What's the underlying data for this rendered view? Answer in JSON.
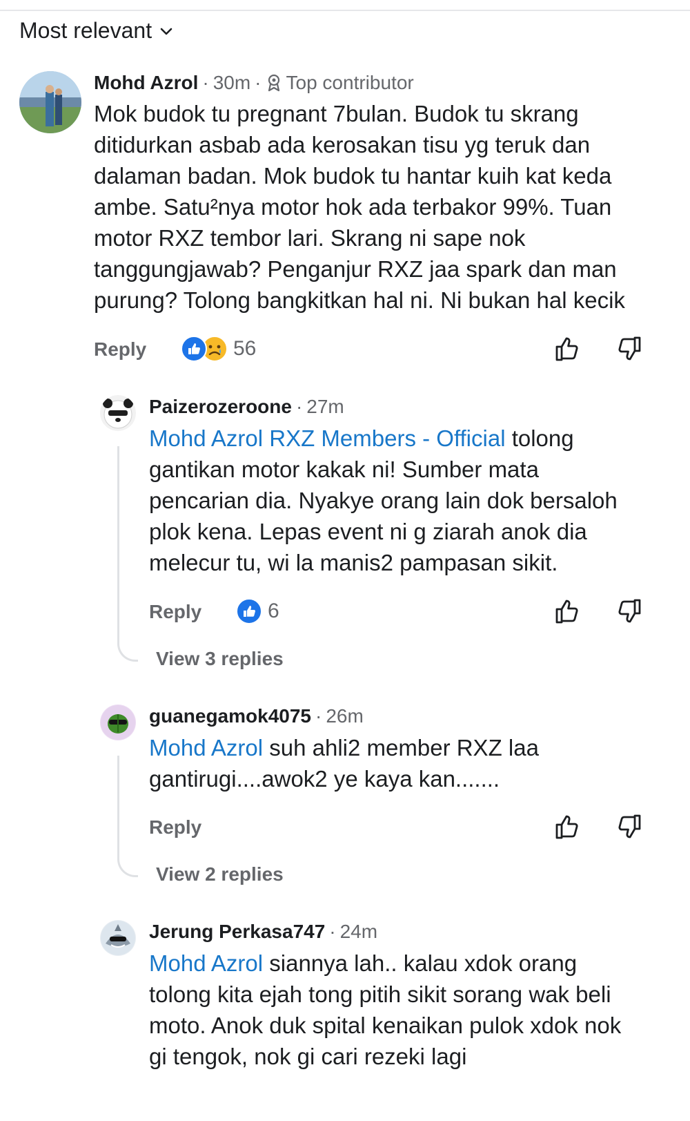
{
  "sort": {
    "label": "Most relevant"
  },
  "comments": [
    {
      "author": "Mohd Azrol",
      "time": "30m",
      "badge": "Top contributor",
      "lines": [
        "Mok budok tu pregnant 7bulan. Budok tu skrang",
        "ditidurkan asbab ada kerosakan tisu yg teruk dan",
        "dalaman badan. Mok budok tu hantar kuih kat keda",
        "ambe. Satu²nya motor hok ada terbakor 99%. Tuan",
        "motor RXZ tembor lari. Skrang ni sape nok",
        "tanggungjawab? Penganjur RXZ jaa spark dan man",
        "purung? Tolong bangkitkan hal ni. Ni bukan hal kecik"
      ],
      "reply_label": "Reply",
      "reaction_count": "56",
      "reactions": [
        "like",
        "sad"
      ]
    },
    {
      "author": "Paizerozeroone",
      "time": "27m",
      "mention": "Mohd Azrol RXZ Members - Official",
      "lines": [
        " tolong",
        "gantikan motor kakak ni! Sumber mata",
        "pencarian dia. Nyakye orang lain dok bersaloh",
        "plok kena. Lepas event ni g ziarah anok dia",
        "melecur tu, wi la manis2 pampasan sikit."
      ],
      "reply_label": "Reply",
      "reaction_count": "6",
      "reactions": [
        "like"
      ],
      "view_replies": "View 3 replies"
    },
    {
      "author": "guanegamok4075",
      "time": "26m",
      "mention": "Mohd Azrol",
      "lines": [
        " suh ahli2 member RXZ laa",
        "gantirugi....awok2 ye kaya kan......."
      ],
      "reply_label": "Reply",
      "view_replies": "View 2 replies"
    },
    {
      "author": "Jerung Perkasa747",
      "time": "24m",
      "mention": "Mohd Azrol",
      "lines": [
        " siannya lah.. kalau xdok orang",
        "tolong kita ejah tong pitih sikit sorang wak beli",
        "moto. Anok duk spital kenaikan pulok xdok nok",
        "gi tengok, nok gi cari rezeki lagi"
      ]
    }
  ]
}
